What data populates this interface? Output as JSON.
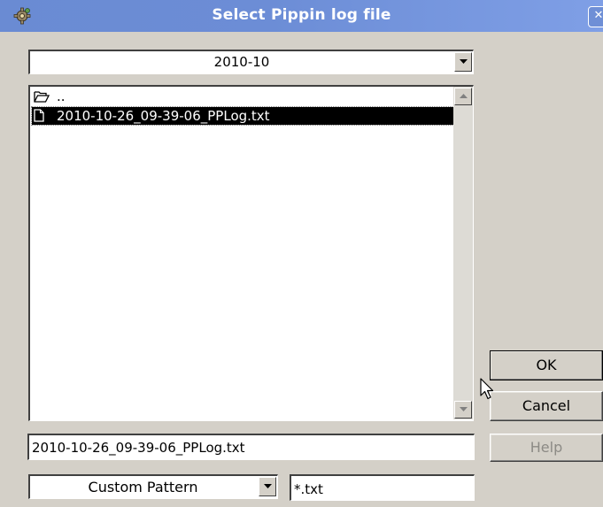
{
  "window": {
    "title": "Select Pippin log file",
    "close_glyph": "✕",
    "icon": "gear-app-icon"
  },
  "folder_combo": {
    "value": "2010-10",
    "arrow_icon": "chevron-down-icon"
  },
  "file_list": {
    "items": [
      {
        "label": "..",
        "icon": "folder-open-icon",
        "selected": false
      },
      {
        "label": "2010-10-26_09-39-06_PPLog.txt",
        "icon": "document-icon",
        "selected": true
      }
    ]
  },
  "buttons": {
    "ok": "OK",
    "cancel": "Cancel",
    "help": "Help"
  },
  "filename_field": {
    "value": "2010-10-26_09-39-06_PPLog.txt"
  },
  "filter_combo": {
    "value": "Custom Pattern",
    "arrow_icon": "chevron-down-icon"
  },
  "pattern_field": {
    "value": "*.txt"
  },
  "colors": {
    "titlebar": "#6c8dd6",
    "dialog_bg": "#d4d0c8",
    "selection_bg": "#000000",
    "selection_fg": "#ffffff",
    "disabled_text": "#8c8a85"
  }
}
